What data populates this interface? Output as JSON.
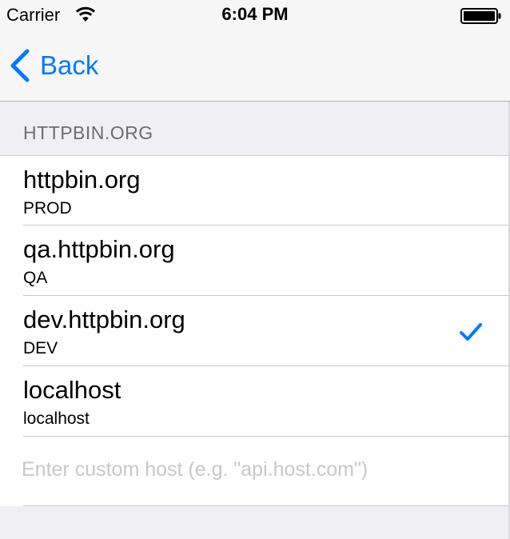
{
  "status_bar": {
    "carrier": "Carrier",
    "time": "6:04 PM",
    "icons": [
      "wifi-icon",
      "battery-icon"
    ]
  },
  "nav": {
    "back_label": "Back",
    "back_icon": "chevron-left-icon",
    "accent_color": "#007aff"
  },
  "section": {
    "header": "HTTPBIN.ORG"
  },
  "hosts": [
    {
      "title": "httpbin.org",
      "subtitle": "PROD",
      "selected": false
    },
    {
      "title": "qa.httpbin.org",
      "subtitle": "QA",
      "selected": false
    },
    {
      "title": "dev.httpbin.org",
      "subtitle": "DEV",
      "selected": true
    },
    {
      "title": "localhost",
      "subtitle": "localhost",
      "selected": false
    }
  ],
  "custom_host": {
    "value": "",
    "placeholder": "Enter custom host (e.g. \"api.host.com\")"
  },
  "colors": {
    "background": "#efeff4",
    "checkmark": "#007aff",
    "section_header_text": "#6d6d72"
  }
}
